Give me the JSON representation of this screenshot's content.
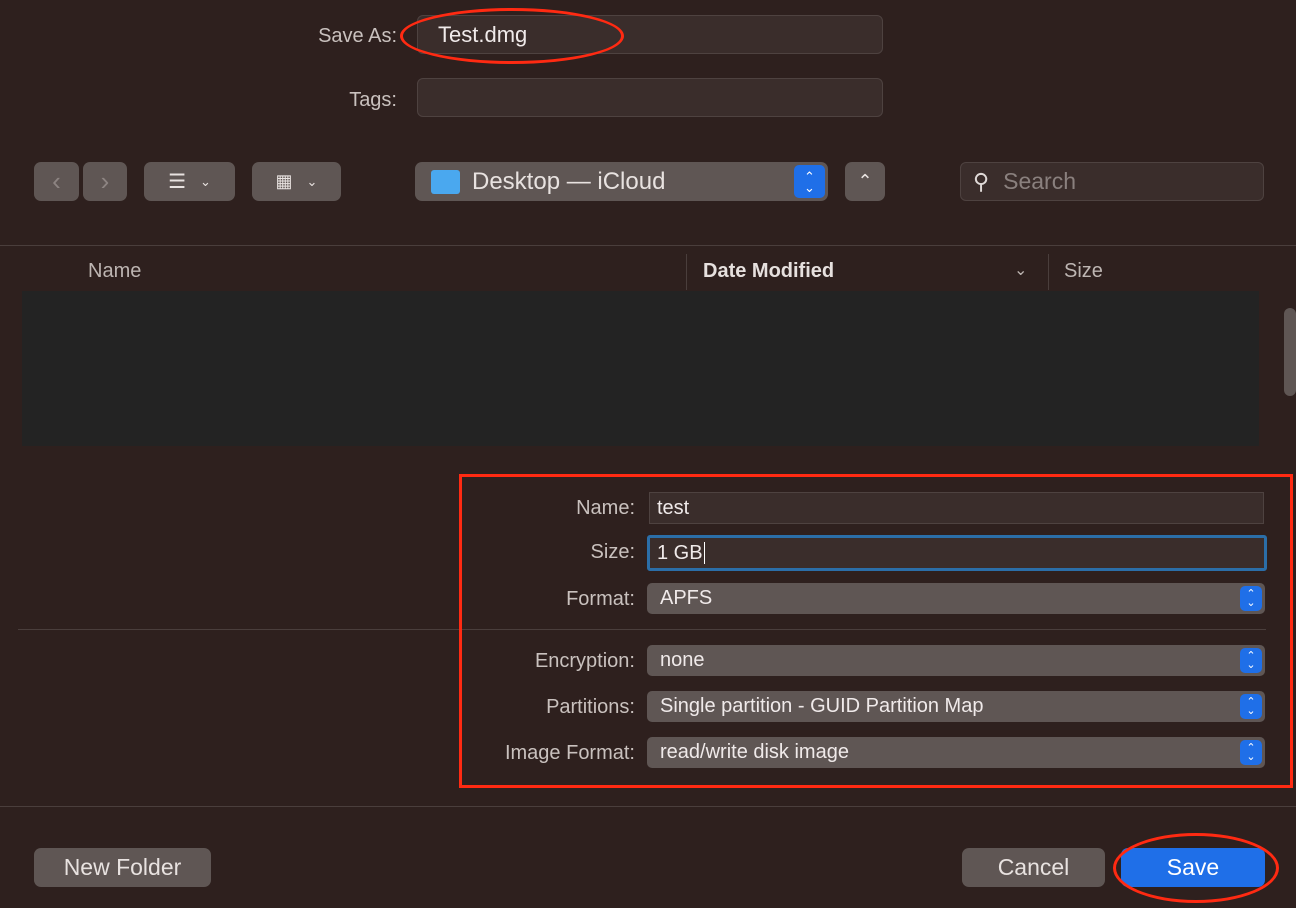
{
  "save_as": {
    "label": "Save As:",
    "value": "Test.dmg"
  },
  "tags": {
    "label": "Tags:",
    "value": ""
  },
  "toolbar": {
    "back_icon": "chevron-left-icon",
    "forward_icon": "chevron-right-icon",
    "list_view_icon": "list-icon",
    "grid_view_icon": "grid-icon",
    "location": "Desktop — iCloud",
    "up_icon": "chevron-up-icon",
    "search_placeholder": "Search"
  },
  "columns": [
    {
      "label": "Name"
    },
    {
      "label": "Date Modified"
    },
    {
      "label": "Size"
    }
  ],
  "options": {
    "name": {
      "label": "Name:",
      "value": "test"
    },
    "size": {
      "label": "Size:",
      "value": "1 GB"
    },
    "format": {
      "label": "Format:",
      "value": "APFS"
    },
    "encryption": {
      "label": "Encryption:",
      "value": "none"
    },
    "partitions": {
      "label": "Partitions:",
      "value": "Single partition - GUID Partition Map"
    },
    "image_format": {
      "label": "Image Format:",
      "value": "read/write disk image"
    }
  },
  "buttons": {
    "new_folder": "New Folder",
    "cancel": "Cancel",
    "save": "Save"
  },
  "colors": {
    "accent": "#1f6fe8",
    "annotation": "#ff2a12",
    "background": "#2e201e"
  }
}
